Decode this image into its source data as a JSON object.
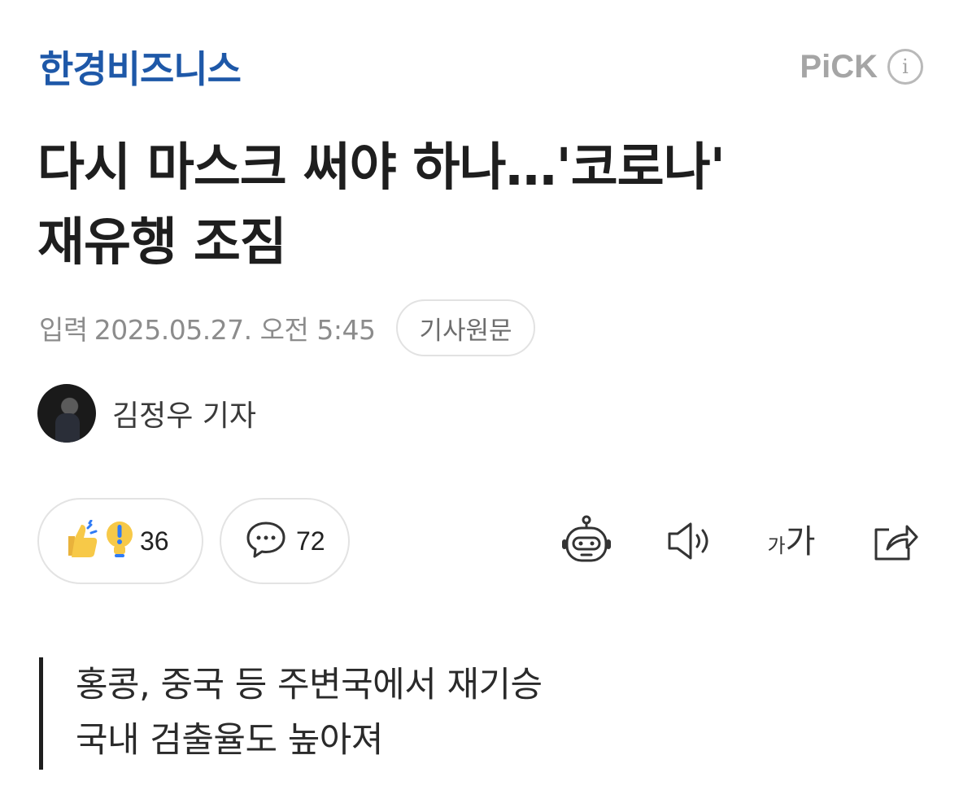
{
  "header": {
    "brand": "한경비즈니스",
    "pick_label": "PiCK",
    "info_icon": "info-icon"
  },
  "article": {
    "title_line1": "다시 마스크 써야 하나…'코로나'",
    "title_line2": "재유행 조짐",
    "date_label": "입력",
    "date_value": "2025.05.27. 오전 5:45",
    "origin_button": "기사원문",
    "author": "김정우 기자"
  },
  "actions": {
    "reaction_count": "36",
    "comment_count": "72",
    "tools": [
      "robot-summary-icon",
      "speaker-icon",
      "font-size-icon",
      "share-icon"
    ],
    "font_size_small": "가",
    "font_size_large": "가"
  },
  "summary": {
    "line1": "홍콩, 중국 등 주변국에서 재기승",
    "line2": "국내 검출율도 높아져"
  },
  "colors": {
    "brand": "#1e58a8",
    "pick": "#a5a5a5",
    "reaction_yellow": "#f7c948",
    "reaction_blue": "#2f7bf6"
  }
}
